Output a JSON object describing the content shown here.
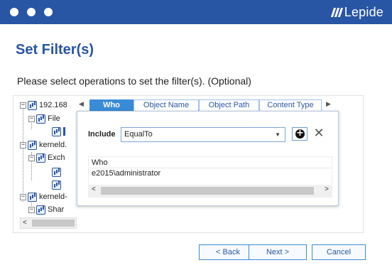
{
  "window": {
    "logo_text": "Lepide",
    "traffic_dots": 3
  },
  "page": {
    "title": "Set Filter(s)",
    "instruction": "Please select operations to set the filter(s). (Optional)"
  },
  "tree": {
    "items": [
      {
        "label": "192.168",
        "expander": "−"
      },
      {
        "label": "File",
        "expander": "−"
      },
      {
        "label": "",
        "expander": ""
      },
      {
        "label": "kerneld.",
        "expander": "−"
      },
      {
        "label": "Exch",
        "expander": "−"
      },
      {
        "label": "",
        "expander": ""
      },
      {
        "label": "",
        "expander": ""
      },
      {
        "label": "kerneld-",
        "expander": "−"
      },
      {
        "label": "Shar",
        "expander": "−"
      }
    ],
    "scroll_left_glyph": "<"
  },
  "tabs": [
    {
      "label": "Who",
      "active": true
    },
    {
      "label": "Object Name",
      "active": false
    },
    {
      "label": "Object Path",
      "active": false
    },
    {
      "label": "Content Type",
      "active": false
    }
  ],
  "filter": {
    "include_label": "Include",
    "operator_value": "EqualTo",
    "add_icon": "plus-circle-icon",
    "remove_icon": "close-icon"
  },
  "grid": {
    "header": "Who",
    "value": "e2015\\administrator"
  },
  "buttons": {
    "back": "< Back",
    "next": "Next >",
    "cancel": "Cancel"
  },
  "colors": {
    "brand": "#2855a4",
    "tab_active": "#3a8bd6"
  }
}
